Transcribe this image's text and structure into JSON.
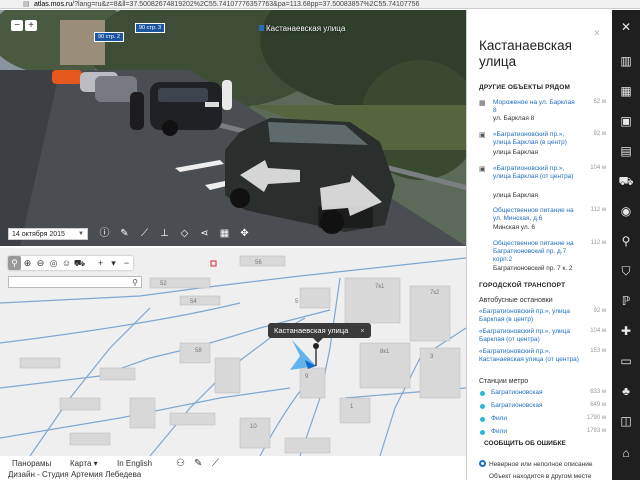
{
  "browser": {
    "host": "atlas.mos.ru",
    "url_rest": "/?lang=ru&z=8&ll=37.50082674819202%2C55.74107776357763&pa=113.68pp=37.50083857%2C55.74107756"
  },
  "pano": {
    "street_title": "Кастанаевская улица",
    "zoom_out": "−",
    "zoom_in": "+",
    "house_badges": [
      "90 стр. 2",
      "90 стр. 3"
    ],
    "date": "14 октября 2015"
  },
  "map": {
    "callout": "Кастанаевская улица",
    "callout_close": "×",
    "buildings": [
      "52",
      "54",
      "56",
      "7к1",
      "7к2",
      "5",
      "8к1",
      "3",
      "1",
      "9",
      "10",
      "58"
    ]
  },
  "bottom": {
    "panoramas": "Панорамы",
    "map": "Карта",
    "english": "In English",
    "credits": "Дизайн - Студия Артемия Лебедева"
  },
  "panel": {
    "title": "Кастанаевская улица",
    "close": "×",
    "nearby_title": "ДРУГИЕ ОБЪЕКТЫ РЯДОМ",
    "nearby": [
      {
        "icon": "shop-icon",
        "name": "Мороженое на ул. Барклая 8",
        "address": "ул. Барклая 8",
        "distance": "62 м"
      },
      {
        "icon": "bus-icon",
        "name": "«Багратионовский пр.», улица Барклая (в центр)",
        "address": "улица Барклая",
        "distance": "92 м"
      },
      {
        "icon": "bus-icon",
        "name": "«Багратионовский пр.», улица Барклая (от центра)",
        "address": "улица Барклая",
        "distance": "104 м"
      },
      {
        "icon": "",
        "name": "Общественное питание на ул. Минская, д.6",
        "address": "Минская ул. 6",
        "distance": "112 м"
      },
      {
        "icon": "",
        "name": "Общественное питание на Багратионовский пр. д.7 корп.2",
        "address": "Багратионовский пр. 7 к. 2",
        "distance": "112 м"
      }
    ],
    "transport_title": "ГОРОДСКОЙ ТРАНСПОРТ",
    "bus_title": "Автобусные остановки",
    "bus_stops": [
      {
        "name": "«Багратионовский пр.», улица Барклая (в центр)",
        "distance": "92 м"
      },
      {
        "name": "«Багратионовский пр.», улица Барклая (от центра)",
        "distance": "104 м"
      },
      {
        "name": "«Багратионовский пр.», Кастанаевская улица (от центра)",
        "distance": "153 м"
      }
    ],
    "metro_title": "Станции метро",
    "metro": [
      {
        "name": "Багратионовская",
        "distance": "633 м"
      },
      {
        "name": "Багратионовская",
        "distance": "649 м"
      },
      {
        "name": "Фили",
        "distance": "1790 м"
      },
      {
        "name": "Фили",
        "distance": "1793 м"
      }
    ],
    "report_title": "СООБЩИТЬ ОБ ОШИБКЕ",
    "report_options": [
      {
        "label": "Неверное или неполное описание",
        "selected": true
      },
      {
        "label": "Объект находится в другом месте",
        "selected": false
      }
    ]
  },
  "colors": {
    "link": "#1e6ec2",
    "metro": "#29b7d8",
    "dark_toolbar": "#1f1f1f",
    "callout": "#3a3a3a"
  }
}
